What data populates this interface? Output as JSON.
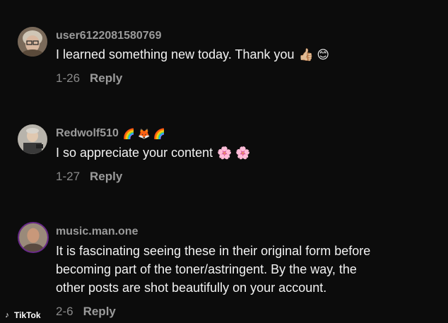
{
  "comments": [
    {
      "username": "user6122081580769",
      "badges": [],
      "text": "I learned something new today. Thank you",
      "emojis": "👍🏼 😊",
      "date": "1-26",
      "reply_label": "Reply"
    },
    {
      "username": "Redwolf510",
      "badges": [
        "🌈",
        "🦊",
        "🌈"
      ],
      "text": "I so appreciate your content",
      "emojis": "🌸 🌸",
      "date": "1-27",
      "reply_label": "Reply"
    },
    {
      "username": "music.man.one",
      "badges": [],
      "text_lines": [
        "It is fascinating seeing these in their original form before",
        "becoming part of the toner/astringent. By the way, the",
        "other posts are shot beautifully on your account."
      ],
      "date": "2-6",
      "reply_label": "Reply"
    }
  ],
  "watermark": {
    "label": "TikTok",
    "icon": "tiktok-logo-icon"
  },
  "colors": {
    "background": "#0c0c0c",
    "username": "#9a9a9a",
    "text": "#f2f2f2",
    "meta": "#8a8a8a"
  }
}
